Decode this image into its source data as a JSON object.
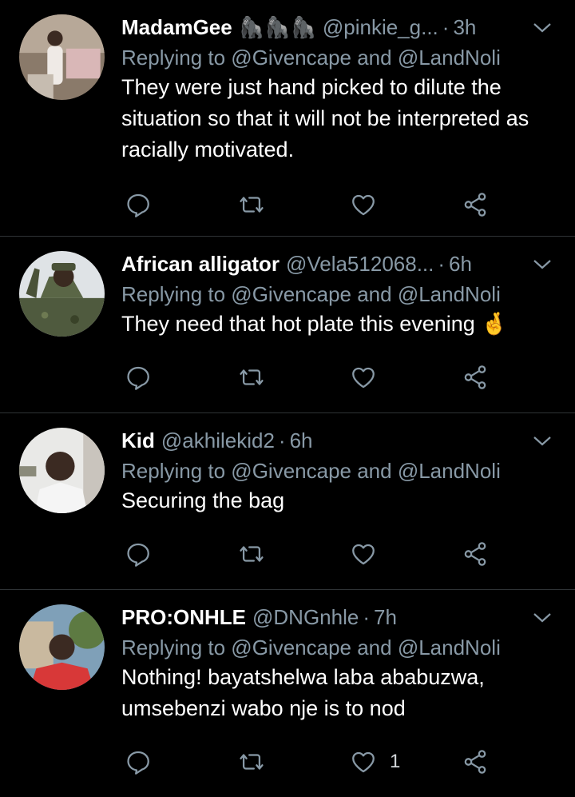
{
  "colors": {
    "background": "#000000",
    "text": "#ffffff",
    "secondary": "#8899a6",
    "divider": "#2f3336"
  },
  "tweets": [
    {
      "name": "MadamGee",
      "emojis": "🦍🦍🦍",
      "handle": "@pinkie_g...",
      "time": "3h",
      "replying": "Replying to @Givencape and @LandNoli",
      "text": "They were just hand picked to dilute the situation so that it will not be interpreted as racially motivated.",
      "like_count": ""
    },
    {
      "name": "African alligator",
      "emojis": "",
      "handle": "@Vela512068...",
      "time": "6h",
      "replying": "Replying to @Givencape and @LandNoli",
      "text": "They need that hot plate this evening 🤞",
      "like_count": ""
    },
    {
      "name": "Kid",
      "emojis": "",
      "handle": "@akhilekid2",
      "time": "6h",
      "replying": "Replying to @Givencape and @LandNoli",
      "text": "Securing the bag",
      "like_count": ""
    },
    {
      "name": "PRO:ONHLE",
      "emojis": "",
      "handle": "@DNGnhle",
      "time": "7h",
      "replying": "Replying to @Givencape and @LandNoli",
      "text": "Nothing! bayatshelwa laba ababuzwa, umsebenzi wabo nje is to nod",
      "like_count": "1"
    }
  ],
  "icons": {
    "reply": "reply-icon",
    "retweet": "retweet-icon",
    "like": "heart-icon",
    "share": "share-icon",
    "more": "chevron-down-icon"
  }
}
